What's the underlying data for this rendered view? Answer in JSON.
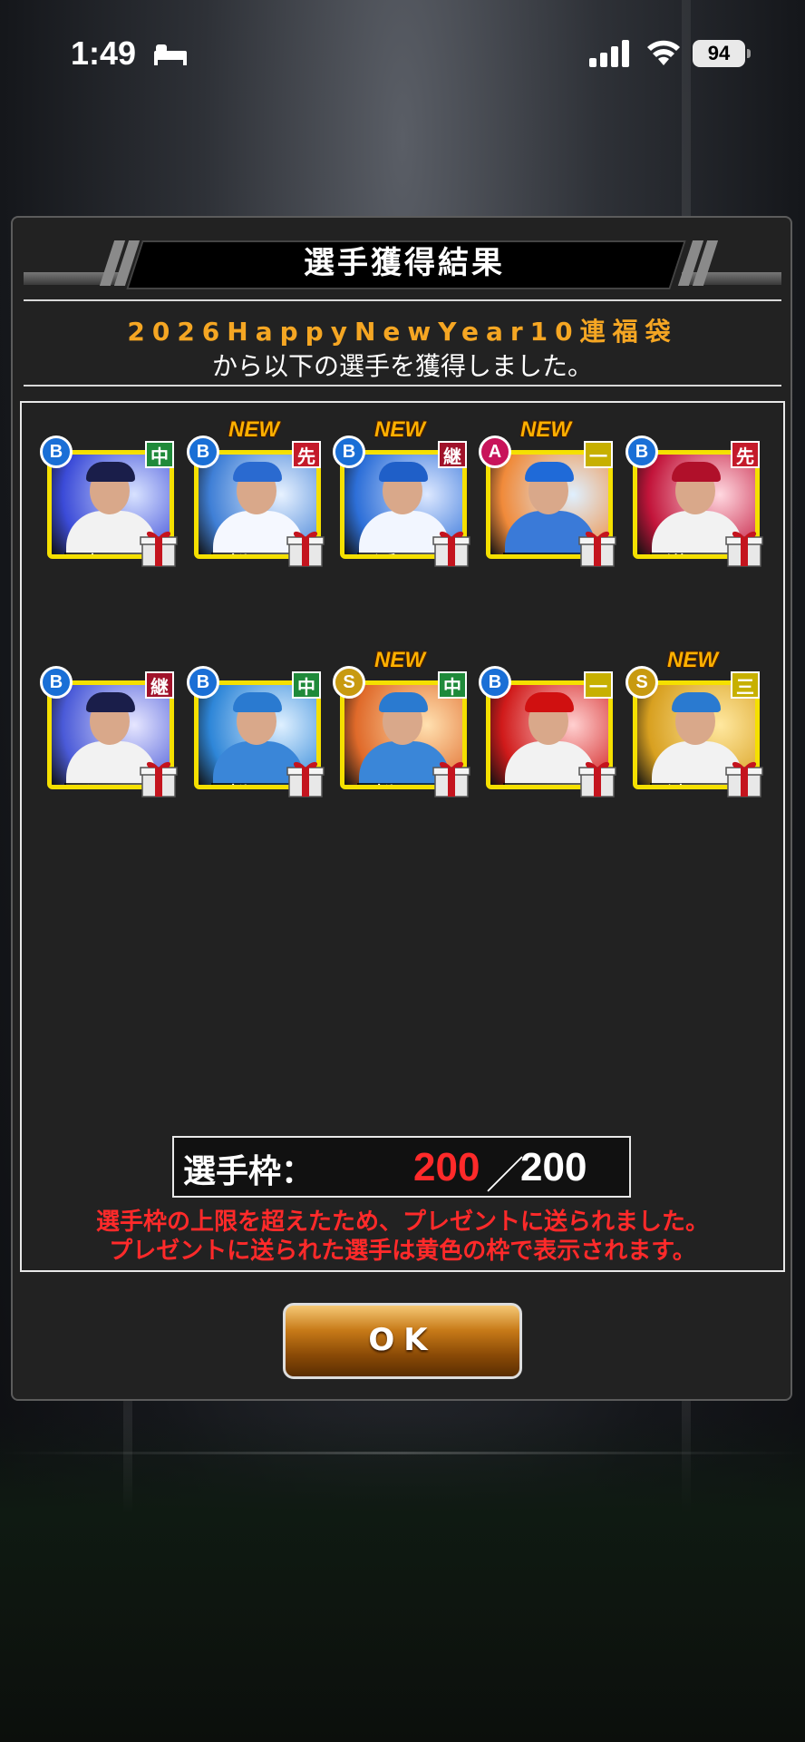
{
  "status_bar": {
    "time": "1:49",
    "battery": "94",
    "icons": [
      "bed-icon",
      "cellular-signal-icon",
      "wifi-icon",
      "battery-icon"
    ]
  },
  "dialog": {
    "title": "選手獲得結果",
    "subtitle_line1": "2026HappyNewYear10連福袋",
    "subtitle_line2": "から以下の選手を獲得しました。"
  },
  "players": [
    {
      "rank": "B",
      "position": "中",
      "name": "岩 田",
      "new": false
    },
    {
      "rank": "B",
      "position": "先",
      "name": "松 坂",
      "new": true
    },
    {
      "rank": "B",
      "position": "継",
      "name": "近 藤",
      "new": true
    },
    {
      "rank": "A",
      "position": "一",
      "name": "レイエ",
      "new": true
    },
    {
      "rank": "B",
      "position": "先",
      "name": "瀧 中",
      "new": false
    },
    {
      "rank": "B",
      "position": "継",
      "name": "阿 部",
      "new": false
    },
    {
      "rank": "B",
      "position": "中",
      "name": "松 本",
      "new": false
    },
    {
      "rank": "S",
      "position": "中",
      "name": "松 本",
      "new": true
    },
    {
      "rank": "B",
      "position": "一",
      "name": "モンテ",
      "new": false
    },
    {
      "rank": "S",
      "position": "三",
      "name": "清 宮",
      "new": true
    }
  ],
  "new_label": "NEW",
  "roster": {
    "label": "選手枠：",
    "current": "200",
    "separator": "／",
    "max": "200"
  },
  "warning": {
    "line1": "選手枠の上限を超えたため、プレゼントに送られました。",
    "line2": "プレゼントに送られた選手は黄色の枠で表示されます。"
  },
  "ok_button": "OK",
  "colors": {
    "accent_orange": "#f5a623",
    "warning_red": "#ff2a2a",
    "card_frame_yellow": "#f5e000",
    "rank_b": "#1a6fd6",
    "rank_a": "#c8145a",
    "rank_s": "#c89a10",
    "pos_center": "#1f8a3a",
    "pos_pitcher": "#c41a2a",
    "pos_relief": "#a0122a",
    "pos_infield": "#c7b000"
  }
}
